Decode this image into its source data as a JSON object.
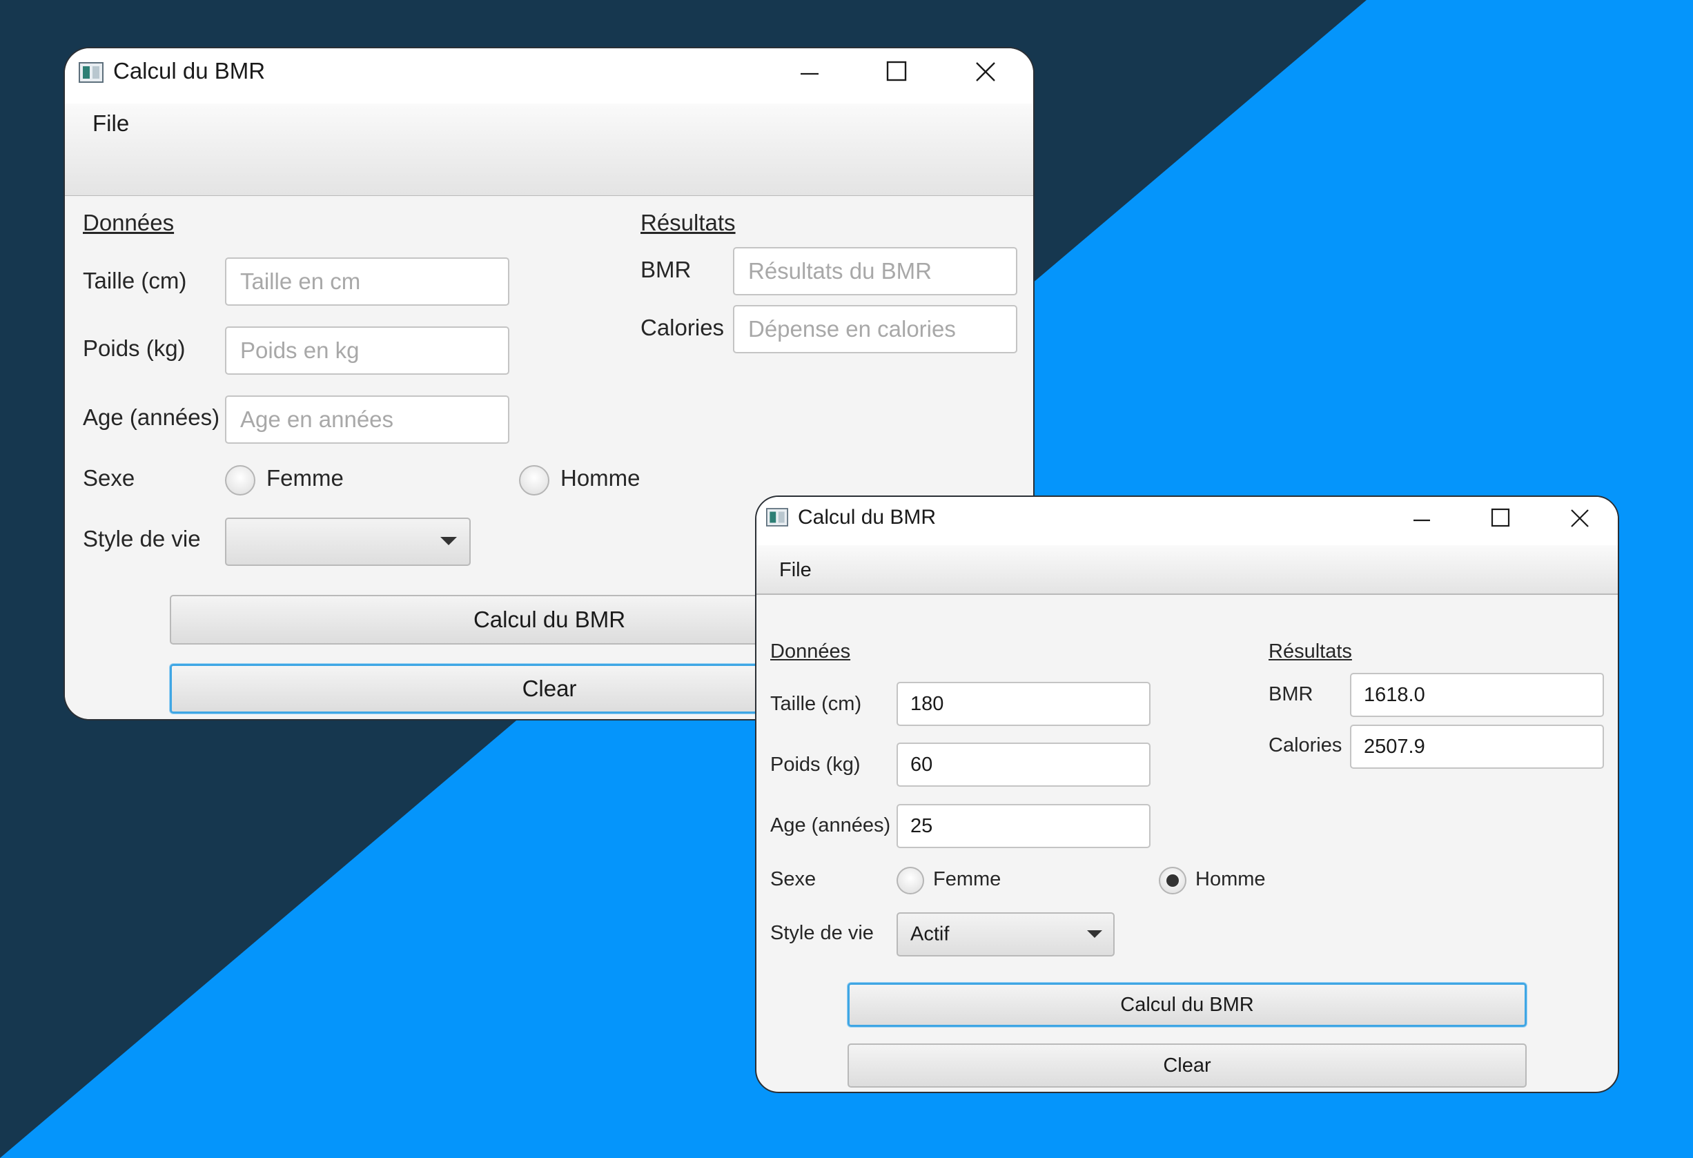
{
  "colors": {
    "background_dark": "#16374f",
    "background_blue": "#0595fb",
    "focus_ring": "#3fa6e4"
  },
  "window_empty": {
    "title": "Calcul du BMR",
    "app_icon": "java-window-icon",
    "controls": [
      "minimize-icon",
      "maximize-icon",
      "close-icon"
    ],
    "menu": {
      "file": "File"
    },
    "donnees_header": "Données",
    "resultats_header": "Résultats",
    "taille": {
      "label": "Taille (cm)",
      "value": "",
      "placeholder": "Taille en cm"
    },
    "poids": {
      "label": "Poids (kg)",
      "value": "",
      "placeholder": "Poids en kg"
    },
    "age": {
      "label": "Age (années)",
      "value": "",
      "placeholder": "Age en années"
    },
    "sexe": {
      "label": "Sexe",
      "femme": "Femme",
      "homme": "Homme",
      "selected": ""
    },
    "style_de_vie": {
      "label": "Style de vie",
      "selected": ""
    },
    "bmr": {
      "label": "BMR",
      "value": "",
      "placeholder": "Résultats du BMR"
    },
    "calories": {
      "label": "Calories",
      "value": "",
      "placeholder": "Dépense en calories"
    },
    "calc_button": "Calcul du BMR",
    "clear_button": "Clear",
    "focused": "clear"
  },
  "window_filled": {
    "title": "Calcul du BMR",
    "app_icon": "java-window-icon",
    "controls": [
      "minimize-icon",
      "maximize-icon",
      "close-icon"
    ],
    "menu": {
      "file": "File"
    },
    "donnees_header": "Données",
    "resultats_header": "Résultats",
    "taille": {
      "label": "Taille (cm)",
      "value": "180"
    },
    "poids": {
      "label": "Poids (kg)",
      "value": "60"
    },
    "age": {
      "label": "Age (années)",
      "value": "25"
    },
    "sexe": {
      "label": "Sexe",
      "femme": "Femme",
      "homme": "Homme",
      "selected": "Homme"
    },
    "style_de_vie": {
      "label": "Style de vie",
      "selected": "Actif"
    },
    "bmr": {
      "label": "BMR",
      "value": "1618.0"
    },
    "calories": {
      "label": "Calories",
      "value": "2507.9"
    },
    "calc_button": "Calcul du BMR",
    "clear_button": "Clear",
    "focused": "calc"
  }
}
